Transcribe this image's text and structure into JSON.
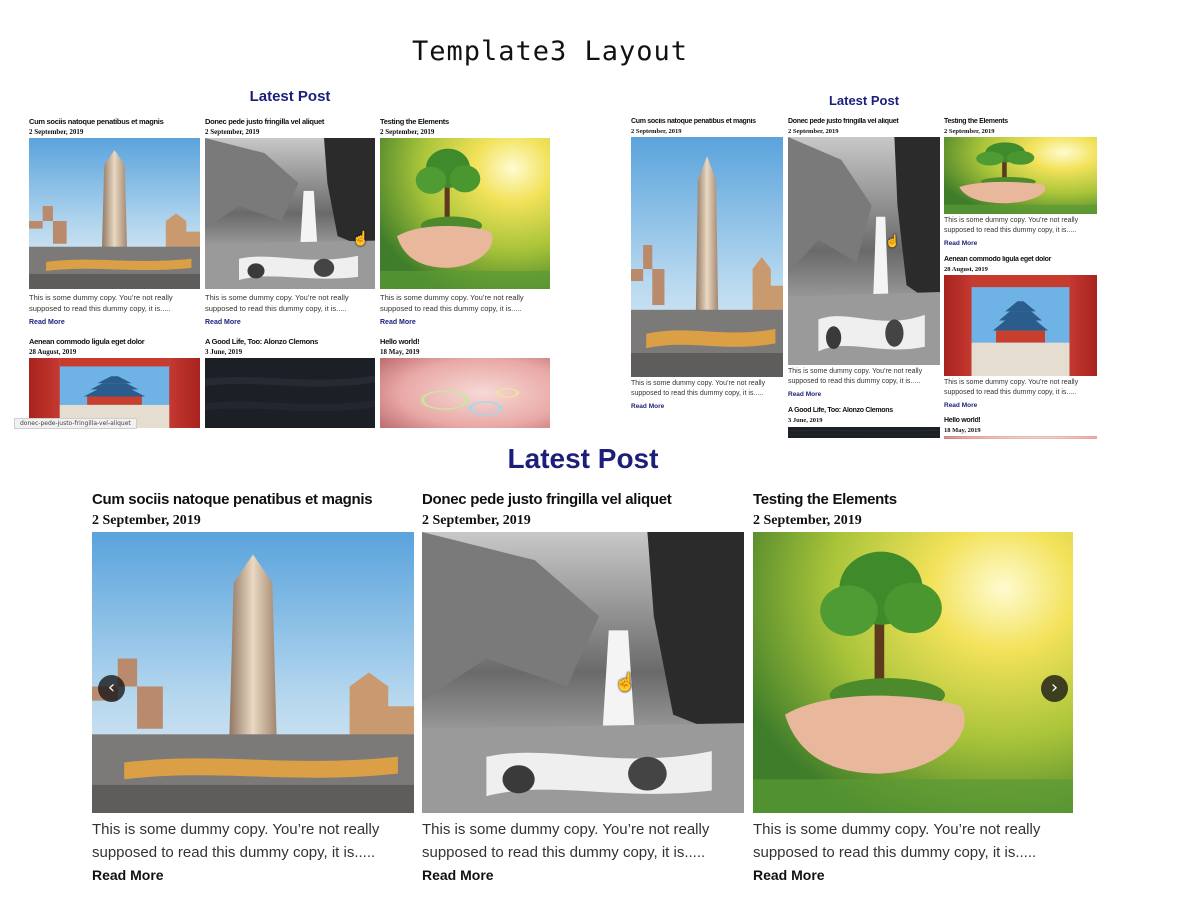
{
  "page_title": "Template3 Layout",
  "section_title": "Latest Post",
  "status_url": "donec-pede-justo-fringilla-vel-aliquet",
  "read_more": "Read More",
  "excerpt": "This is some dummy copy. You’re not really supposed to read this dummy copy, it is.....",
  "excerpt_line1": "This is some dummy copy. You’re not really",
  "excerpt_line2": "supposed to read this dummy copy, it is.....",
  "posts": [
    {
      "title": "Cum sociis natoque penatibus et magnis",
      "date": "2 September, 2019",
      "image": "flatiron-building"
    },
    {
      "title": "Donec pede justo fringilla vel aliquet",
      "date": "2 September, 2019",
      "image": "waterfall"
    },
    {
      "title": "Testing the Elements",
      "date": "2 September, 2019",
      "image": "tree-in-hands"
    },
    {
      "title": "Aenean commodo ligula eget dolor",
      "date": "28 August, 2019",
      "image": "temple-gate"
    },
    {
      "title": "A Good Life, Too: Alonzo Clemons",
      "date": "3 June, 2019",
      "image": "dark-fabric"
    },
    {
      "title": "Hello world!",
      "date": "18 May, 2019",
      "image": "bubbles"
    }
  ],
  "carousel": {
    "prev_icon": "chevron-left-icon",
    "next_icon": "chevron-right-icon",
    "prev": "‹",
    "next": "›"
  },
  "colors": {
    "accent": "#1b1f7a",
    "text": "#222222"
  }
}
